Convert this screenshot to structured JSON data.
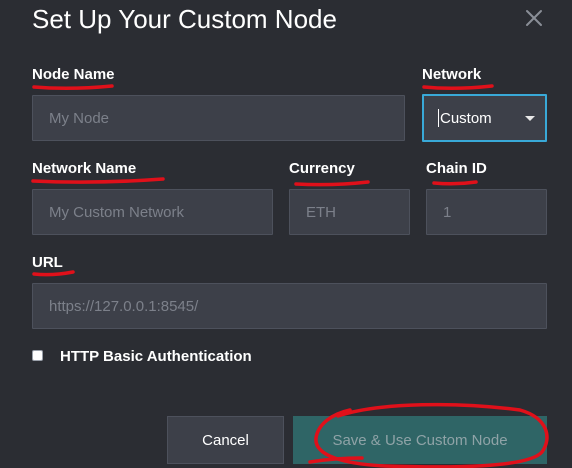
{
  "dialog": {
    "title": "Set Up Your Custom Node",
    "close_label": "×"
  },
  "form": {
    "node_name": {
      "label": "Node Name",
      "placeholder": "My Node",
      "value": ""
    },
    "network": {
      "label": "Network",
      "selected": "Custom"
    },
    "network_name": {
      "label": "Network Name",
      "placeholder": "My Custom Network",
      "value": ""
    },
    "currency": {
      "label": "Currency",
      "placeholder": "ETH",
      "value": ""
    },
    "chain_id": {
      "label": "Chain ID",
      "placeholder": "1",
      "value": ""
    },
    "url": {
      "label": "URL",
      "placeholder": "https://127.0.0.1:8545/",
      "value": ""
    },
    "http_basic_auth": {
      "label": "HTTP Basic Authentication",
      "checked": false
    }
  },
  "actions": {
    "cancel_label": "Cancel",
    "save_label": "Save & Use Custom Node"
  },
  "colors": {
    "background": "#2b2d33",
    "field_bg": "#3d4049",
    "focus_border": "#39a9d8",
    "save_bg": "#2f6566",
    "annotation": "#e0101a"
  }
}
